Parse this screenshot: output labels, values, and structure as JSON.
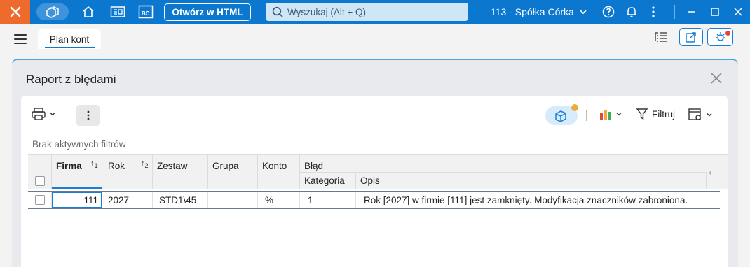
{
  "titlebar": {
    "html_button": "Otwórz w HTML",
    "search_placeholder": "Wyszukaj (Alt + Q)",
    "company": "113 - Spółka Córka",
    "bc_label": "BC"
  },
  "workspace": {
    "tab": "Plan kont"
  },
  "dialog": {
    "title": "Raport z błędami",
    "filter_button": "Filtruj",
    "filters_status": "Brak aktywnych filtrów"
  },
  "grid": {
    "columns": {
      "firma": "Firma",
      "firma_sort": "1",
      "rok": "Rok",
      "rok_sort": "2",
      "zestaw": "Zestaw",
      "grupa": "Grupa",
      "konto": "Konto",
      "blad": "Błąd",
      "kategoria": "Kategoria",
      "opis": "Opis"
    },
    "rows": [
      {
        "firma": "111",
        "rok": "2027",
        "zestaw": "STD1\\45",
        "grupa": "",
        "konto": "%",
        "kategoria": "1",
        "opis": "Rok [2027] w firmie [111] jest zamknięty.  Modyfikacja znaczników zabroniona."
      }
    ]
  },
  "colors": {
    "titlebar": "#0b77cf",
    "logo": "#ef6a2d",
    "accent": "#1a7fd4",
    "badge_orange": "#f0a93c",
    "badge_red": "#e5453a"
  }
}
